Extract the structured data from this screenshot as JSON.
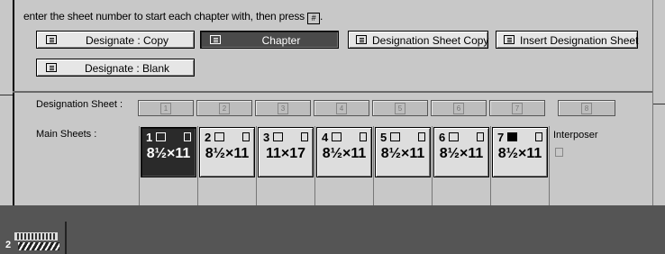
{
  "instruction": "enter the sheet number to start each chapter with, then press",
  "instruction_key": "#",
  "buttons": {
    "designate_copy": "Designate : Copy",
    "chapter": "Chapter",
    "designation_sheet_copy": "Designation Sheet Copy",
    "insert_designation_sheet": "Insert Designation Sheet",
    "designate_blank": "Designate : Blank"
  },
  "labels": {
    "designation_sheet": "Designation Sheet :",
    "main_sheets": "Main Sheets :",
    "interposer": "Interposer"
  },
  "designation_slots": [
    "1",
    "2",
    "3",
    "4",
    "5",
    "6",
    "7",
    "8"
  ],
  "main_sheets": [
    {
      "num": "1",
      "size": "8½×11",
      "selected": true
    },
    {
      "num": "2",
      "size": "8½×11",
      "selected": false
    },
    {
      "num": "3",
      "size": "11×17",
      "selected": false
    },
    {
      "num": "4",
      "size": "8½×11",
      "selected": false
    },
    {
      "num": "5",
      "size": "8½×11",
      "selected": false
    },
    {
      "num": "6",
      "size": "8½×11",
      "selected": false
    },
    {
      "num": "7",
      "size": "8½×11",
      "selected": false
    }
  ],
  "footer": {
    "tray_number": "2"
  }
}
